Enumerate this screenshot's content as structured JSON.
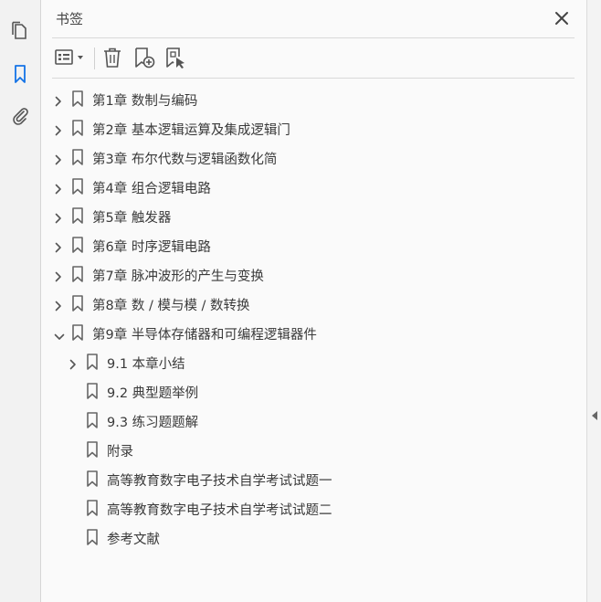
{
  "panel": {
    "title": "书签",
    "close_icon": "close-icon",
    "sidebar_icons": [
      "pages-icon",
      "bookmark-icon",
      "attachment-icon"
    ],
    "toolbar": [
      "options-menu-icon",
      "delete-icon",
      "new-bookmark-icon",
      "new-bookmark-from-structure-icon"
    ]
  },
  "bookmarks": [
    {
      "label": "第1章 数制与编码",
      "level": 0,
      "expander": "collapsed"
    },
    {
      "label": "第2章 基本逻辑运算及集成逻辑门",
      "level": 0,
      "expander": "collapsed"
    },
    {
      "label": "第3章 布尔代数与逻辑函数化简",
      "level": 0,
      "expander": "collapsed"
    },
    {
      "label": "第4章 组合逻辑电路",
      "level": 0,
      "expander": "collapsed"
    },
    {
      "label": "第5章 触发器",
      "level": 0,
      "expander": "collapsed"
    },
    {
      "label": "第6章 时序逻辑电路",
      "level": 0,
      "expander": "collapsed"
    },
    {
      "label": "第7章 脉冲波形的产生与变换",
      "level": 0,
      "expander": "collapsed"
    },
    {
      "label": "第8章 数 / 模与模 / 数转换",
      "level": 0,
      "expander": "collapsed"
    },
    {
      "label": "第9章 半导体存储器和可编程逻辑器件",
      "level": 0,
      "expander": "expanded"
    },
    {
      "label": "9.1 本章小结",
      "level": 1,
      "expander": "collapsed"
    },
    {
      "label": "9.2 典型题举例",
      "level": 1,
      "expander": "none"
    },
    {
      "label": "9.3 练习题题解",
      "level": 1,
      "expander": "none"
    },
    {
      "label": "附录",
      "level": 1,
      "expander": "none"
    },
    {
      "label": "高等教育数字电子技术自学考试试题一",
      "level": 1,
      "expander": "none"
    },
    {
      "label": "高等教育数字电子技术自学考试试题二",
      "level": 1,
      "expander": "none"
    },
    {
      "label": "参考文献",
      "level": 1,
      "expander": "none"
    }
  ]
}
